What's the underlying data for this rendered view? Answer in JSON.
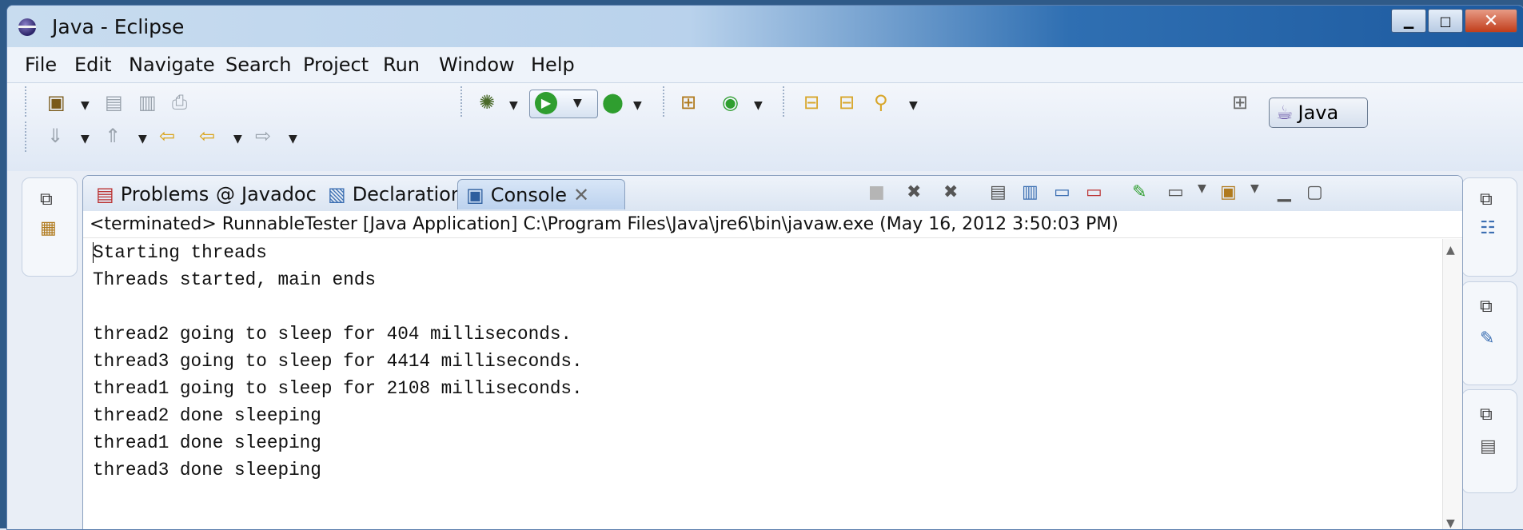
{
  "window": {
    "title": "Java - Eclipse",
    "controls": {
      "minimize": "▁",
      "maximize": "□",
      "close": "✕"
    }
  },
  "menu": [
    {
      "label": "File"
    },
    {
      "label": "Edit"
    },
    {
      "label": "Navigate"
    },
    {
      "label": "Search"
    },
    {
      "label": "Project"
    },
    {
      "label": "Run"
    },
    {
      "label": "Window"
    },
    {
      "label": "Help"
    }
  ],
  "perspective": {
    "label": "Java",
    "icon": "java-perspective-icon"
  },
  "views": {
    "tabs": [
      {
        "label": "Problems",
        "icon": "problems-icon"
      },
      {
        "label": "Javadoc",
        "icon": "javadoc-icon"
      },
      {
        "label": "Declaration",
        "icon": "declaration-icon"
      },
      {
        "label": "Console",
        "icon": "console-icon",
        "active": true
      }
    ]
  },
  "console": {
    "description": "<terminated> RunnableTester [Java Application] C:\\Program Files\\Java\\jre6\\bin\\javaw.exe (May 16, 2012 3:50:03 PM)",
    "lines": [
      "Starting threads",
      "Threads started, main ends",
      "",
      "thread2 going to sleep for 404 milliseconds.",
      "thread3 going to sleep for 4414 milliseconds.",
      "thread1 going to sleep for 2108 milliseconds.",
      "thread2 done sleeping",
      "thread1 done sleeping",
      "thread3 done sleeping"
    ]
  },
  "colors": {
    "titlebar_accent": "#1d5a9f",
    "active_tab": "#bcd2ee",
    "run_green": "#2f9e2f"
  }
}
